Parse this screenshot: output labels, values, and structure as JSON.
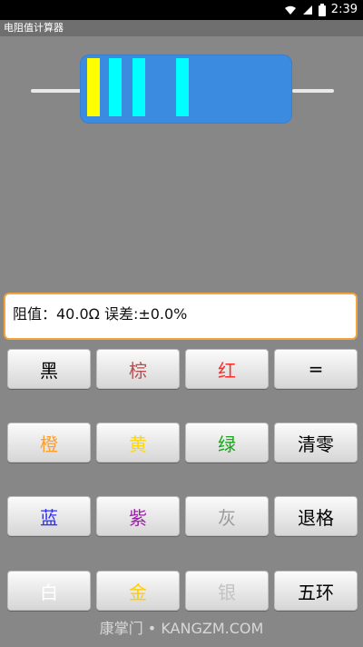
{
  "status": {
    "time": "2:39"
  },
  "app": {
    "title": "电阻值计算器"
  },
  "resistor": {
    "bands": [
      "#ffff00",
      "#00ffff",
      "#00ffff",
      "#00ffff"
    ]
  },
  "result": {
    "text": "阻值：40.0Ω 误差:±0.0%"
  },
  "buttons": [
    {
      "label": "黑",
      "color": "#000000"
    },
    {
      "label": "棕",
      "color": "#b35151"
    },
    {
      "label": "红",
      "color": "#ff2b2b"
    },
    {
      "label": "=",
      "color": "#000000"
    },
    {
      "label": "橙",
      "color": "#ff9f2a"
    },
    {
      "label": "黄",
      "color": "#ffd800"
    },
    {
      "label": "绿",
      "color": "#1aa61a"
    },
    {
      "label": "清零",
      "color": "#000000"
    },
    {
      "label": "蓝",
      "color": "#2c2cff"
    },
    {
      "label": "紫",
      "color": "#9b1fa8"
    },
    {
      "label": "灰",
      "color": "#9a9a9a"
    },
    {
      "label": "退格",
      "color": "#000000"
    },
    {
      "label": "白",
      "color": "#ffffff"
    },
    {
      "label": "金",
      "color": "#ffcc00"
    },
    {
      "label": "银",
      "color": "#c3c3c3"
    },
    {
      "label": "五环",
      "color": "#000000"
    }
  ],
  "watermark": {
    "text": "康掌门 • KANGZM.COM"
  }
}
